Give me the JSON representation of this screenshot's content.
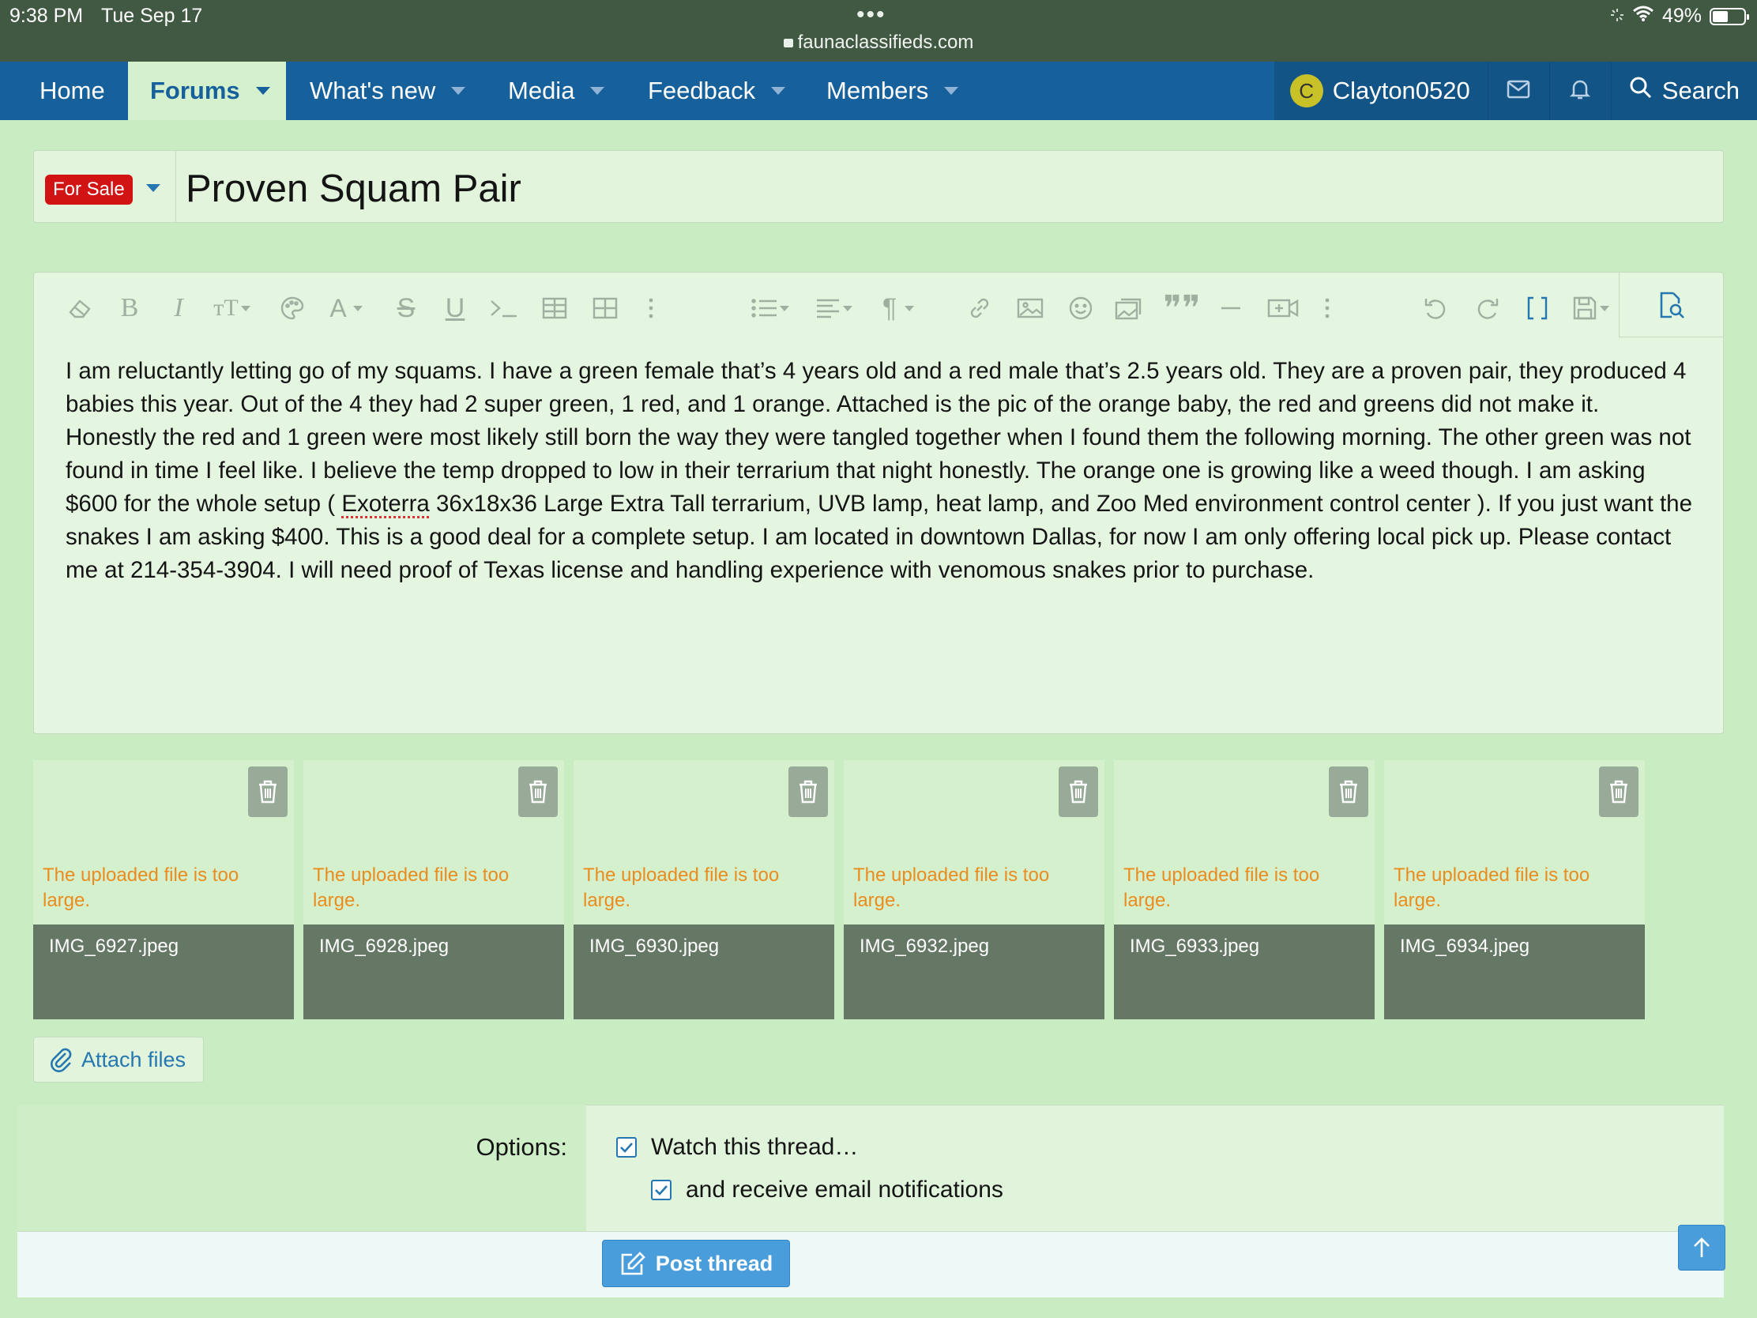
{
  "status_bar": {
    "time": "9:38 PM",
    "date": "Tue Sep 17",
    "url": "faunaclassifieds.com",
    "battery": "49%",
    "battery_level": 0.49
  },
  "nav": {
    "items": [
      {
        "label": "Home"
      },
      {
        "label": "Forums"
      },
      {
        "label": "What's new"
      },
      {
        "label": "Media"
      },
      {
        "label": "Feedback"
      },
      {
        "label": "Members"
      }
    ],
    "username": "Clayton0520",
    "avatar_letter": "C",
    "search_label": "Search"
  },
  "thread": {
    "prefix": "For Sale",
    "title": "Proven Squam Pair",
    "body_before": "I am reluctantly letting go of my squams.  I have a green female that’s 4 years old and a red male that’s 2.5 years old. They are a proven pair, they produced 4 babies this year.  Out of the 4 they had 2 super green, 1 red, and 1 orange.  Attached is the pic of the orange baby, the red and greens did not make it. Honestly the red and 1 green were most likely still born the way they were tangled together when I found them the following morning. The other green was not found in time I feel like.  I believe the temp dropped to low in their terrarium that night honestly.  The orange one is growing like a weed though. I am asking $600 for the whole setup ( ",
    "body_spell": "Exoterra",
    "body_after": " 36x18x36 Large Extra Tall terrarium, UVB lamp, heat lamp, and Zoo Med environment control center ).    If you just want the snakes I am asking $400. This is a good deal for a complete setup. I am located in downtown Dallas, for now I am only offering local pick up. Please contact me at 214-354-3904.  I will need proof of Texas license and handling experience with venomous snakes prior to purchase."
  },
  "attachments": [
    {
      "error": "The uploaded file is too large.",
      "filename": "IMG_6927.jpeg"
    },
    {
      "error": "The uploaded file is too large.",
      "filename": "IMG_6928.jpeg"
    },
    {
      "error": "The uploaded file is too large.",
      "filename": "IMG_6930.jpeg"
    },
    {
      "error": "The uploaded file is too large.",
      "filename": "IMG_6932.jpeg"
    },
    {
      "error": "The uploaded file is too large.",
      "filename": "IMG_6933.jpeg"
    },
    {
      "error": "The uploaded file is too large.",
      "filename": "IMG_6934.jpeg"
    }
  ],
  "attach_label": "Attach files",
  "options": {
    "label": "Options:",
    "watch": "Watch this thread…",
    "email": "and receive email notifications"
  },
  "post_label": "Post thread",
  "colors": {
    "nav": "#16609b",
    "status_bar": "#415842",
    "accent": "#2577b1",
    "prefix_red": "#d11313",
    "error_orange": "#ea8c1e",
    "page_bg": "#c9ecc2"
  }
}
